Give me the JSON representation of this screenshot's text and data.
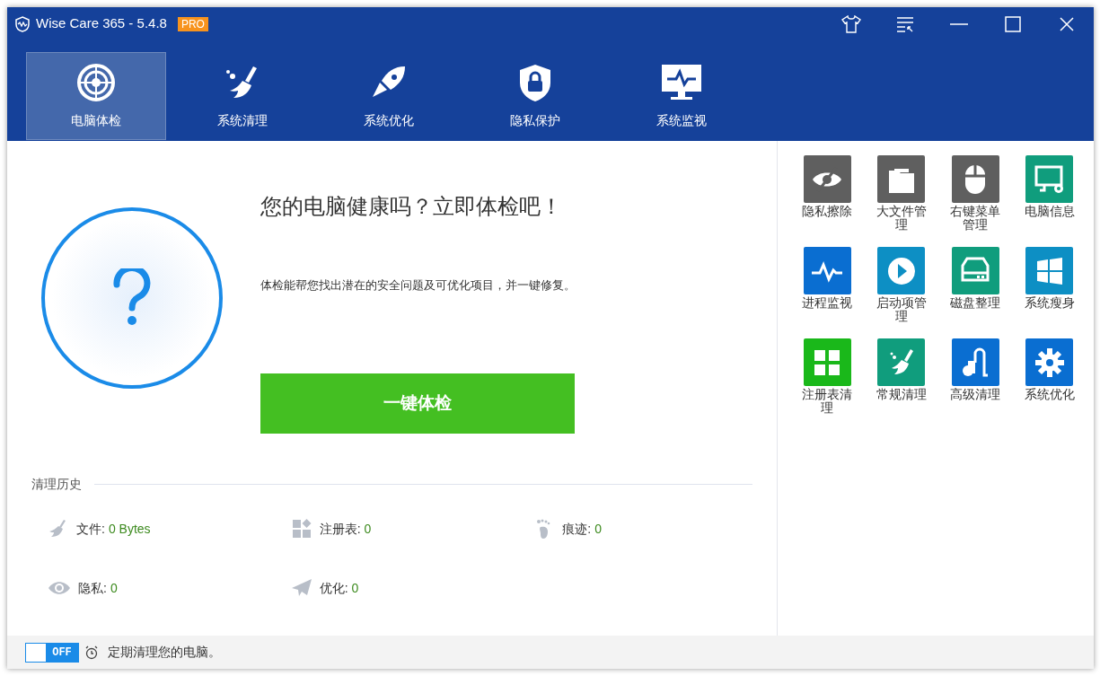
{
  "window": {
    "title": "Wise Care 365 - 5.4.8",
    "badge": "PRO"
  },
  "tabs": [
    {
      "label": "电脑体检",
      "kind": "radar",
      "selected": true
    },
    {
      "label": "系统清理",
      "kind": "broom",
      "selected": false
    },
    {
      "label": "系统优化",
      "kind": "rocket",
      "selected": false
    },
    {
      "label": "隐私保护",
      "kind": "shield",
      "selected": false
    },
    {
      "label": "系统监视",
      "kind": "monitor",
      "selected": false
    }
  ],
  "checkup": {
    "heading": "您的电脑健康吗？立即体检吧！",
    "description": "体检能帮您找出潜在的安全问题及可优化项目，并一键修复。",
    "button": "一键体检"
  },
  "history": {
    "title": "清理历史",
    "items": [
      {
        "kind": "broom",
        "label": "文件:",
        "value": "0 Bytes"
      },
      {
        "kind": "tiles",
        "label": "注册表:",
        "value": "0"
      },
      {
        "kind": "foot",
        "label": "痕迹:",
        "value": "0"
      },
      {
        "kind": "eye",
        "label": "隐私:",
        "value": "0"
      },
      {
        "kind": "plane",
        "label": "优化:",
        "value": "0"
      }
    ]
  },
  "tools": [
    {
      "label": "隐私擦除",
      "kind": "eye-off",
      "color": "#5f5f5f"
    },
    {
      "label": "大文件管理",
      "kind": "folder",
      "color": "#5f5f5f"
    },
    {
      "label": "右键菜单管理",
      "kind": "mouse",
      "color": "#5f5f5f"
    },
    {
      "label": "电脑信息",
      "kind": "pc",
      "color": "#109d7d"
    },
    {
      "label": "进程监视",
      "kind": "pulse",
      "color": "#0a6ed1"
    },
    {
      "label": "启动项管理",
      "kind": "play",
      "color": "#0d8fc4"
    },
    {
      "label": "磁盘整理",
      "kind": "disk",
      "color": "#109d7d"
    },
    {
      "label": "系统瘦身",
      "kind": "windows",
      "color": "#0d8fc4"
    },
    {
      "label": "注册表清理",
      "kind": "grid",
      "color": "#1ab81a"
    },
    {
      "label": "常规清理",
      "kind": "broom",
      "color": "#109d7d"
    },
    {
      "label": "高级清理",
      "kind": "vacuum",
      "color": "#0a6ed1"
    },
    {
      "label": "系统优化",
      "kind": "gear",
      "color": "#0a6ed1"
    }
  ],
  "footer": {
    "toggle": {
      "label": "OFF",
      "on": false
    },
    "text": "定期清理您的电脑。"
  }
}
